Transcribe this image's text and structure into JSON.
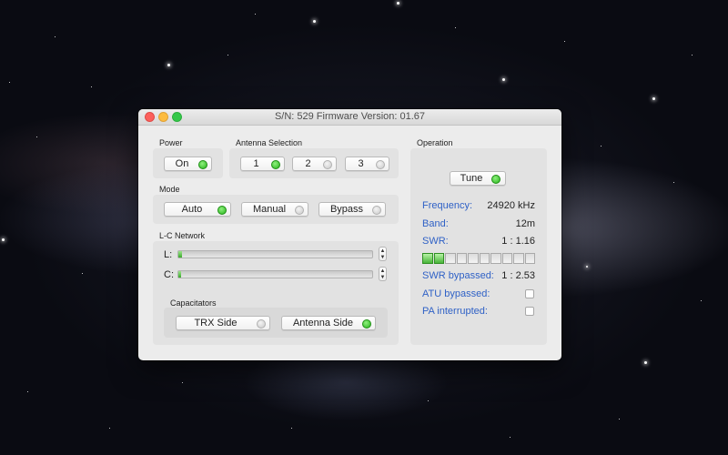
{
  "window": {
    "title": "S/N:  529  Firmware Version: 01.67"
  },
  "power": {
    "label": "Power",
    "button": {
      "label": "On",
      "led": "on"
    }
  },
  "antenna": {
    "label": "Antenna Selection",
    "buttons": [
      {
        "label": "1",
        "led": "on"
      },
      {
        "label": "2",
        "led": "off"
      },
      {
        "label": "3",
        "led": "off"
      }
    ]
  },
  "mode": {
    "label": "Mode",
    "buttons": [
      {
        "label": "Auto",
        "led": "on"
      },
      {
        "label": "Manual",
        "led": "off"
      },
      {
        "label": "Bypass",
        "led": "off"
      }
    ]
  },
  "lc_network": {
    "label": "L-C Network",
    "l": {
      "label": "L:",
      "level": 0.02
    },
    "c": {
      "label": "C:",
      "level": 0.005
    },
    "capacitators": {
      "label": "Capacitators",
      "buttons": [
        {
          "label": "TRX Side",
          "led": "off"
        },
        {
          "label": "Antenna Side",
          "led": "on"
        }
      ]
    }
  },
  "operation": {
    "label": "Operation",
    "tune": {
      "label": "Tune",
      "led": "on"
    },
    "frequency": {
      "label": "Frequency:",
      "value": "24920 kHz"
    },
    "band": {
      "label": "Band:",
      "value": "12m"
    },
    "swr": {
      "label": "SWR:",
      "value": "1 : 1.16",
      "meter_segments": 10,
      "meter_lit": 2
    },
    "swr_bypassed": {
      "label": "SWR bypassed:",
      "value": "1 : 2.53"
    },
    "atu_bypassed": {
      "label": "ATU bypassed:",
      "checked": false
    },
    "pa_interrupted": {
      "label": "PA interrupted:",
      "checked": false
    }
  },
  "colors": {
    "led_on": "#27b51b",
    "accent_text": "#2f61c6"
  }
}
